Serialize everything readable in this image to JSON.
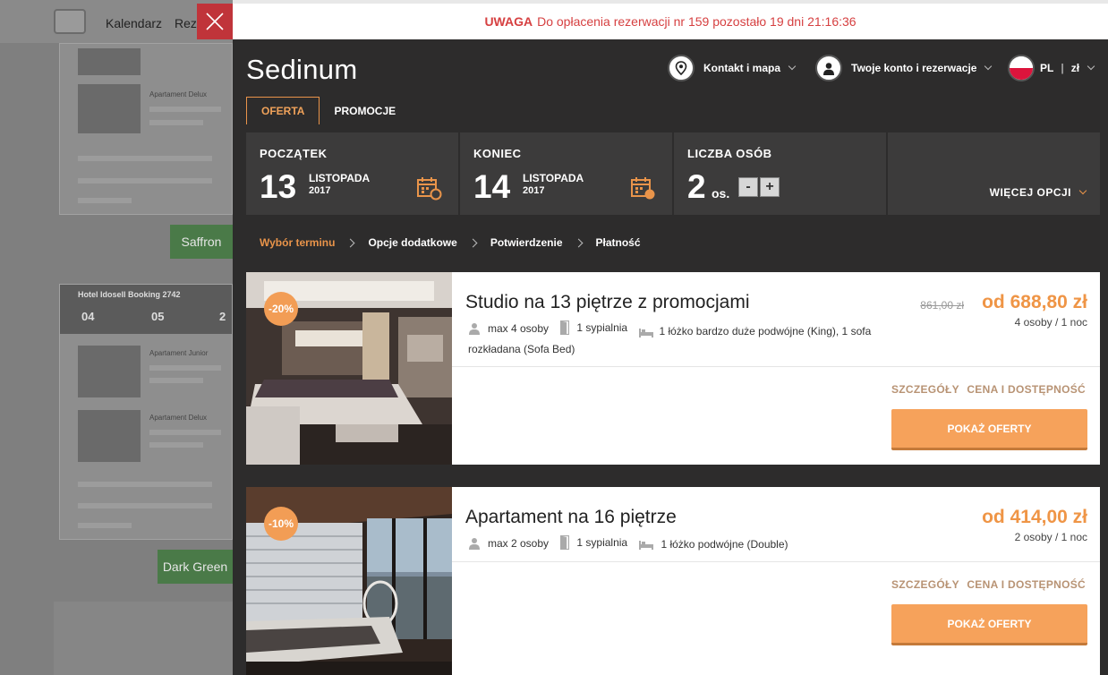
{
  "background": {
    "nav": {
      "calendar": "Kalendarz",
      "reservations": "Reze"
    },
    "preview_hotel": "Hotel Idosell Booking 2742",
    "preview_rooms": [
      "Apartament Junior",
      "Apartament Delux"
    ],
    "preview_days": [
      "04",
      "05",
      "2"
    ],
    "theme_buttons": [
      "Saffron",
      "Dark Green"
    ]
  },
  "warning": {
    "label": "UWAGA",
    "text": "Do opłacenia rezerwacji nr 159 pozostało 19 dni 21:16:36"
  },
  "hotel": {
    "name": "Sedinum"
  },
  "menu": {
    "contact": "Kontakt i mapa",
    "account": "Twoje konto i rezerwacje",
    "lang": "PL",
    "currency": "zł"
  },
  "tabs": [
    "OFERTA",
    "PROMOCJE"
  ],
  "search": {
    "start": {
      "label": "POCZĄTEK",
      "day": "13",
      "month": "LISTOPADA",
      "year": "2017"
    },
    "end": {
      "label": "KONIEC",
      "day": "14",
      "month": "LISTOPADA",
      "year": "2017"
    },
    "people": {
      "label": "LICZBA OSÓB",
      "count": "2",
      "unit": "os.",
      "minus": "-",
      "plus": "+"
    },
    "more": "WIĘCEJ OPCJI"
  },
  "steps": [
    "Wybór terminu",
    "Opcje dodatkowe",
    "Potwierdzenie",
    "Płatność"
  ],
  "offers": [
    {
      "title": "Studio na 13 piętrze z promocjami",
      "badge": "-20%",
      "guests": "max 4 osoby",
      "bedrooms": "1 sypialnia",
      "beds": "1 łóżko bardzo duże podwójne (King), 1 sofa rozkładana (Sofa Bed)",
      "old_price": "861,00 zł",
      "price": "od 688,80 zł",
      "per": "4 osoby / 1 noc",
      "details": "SZCZEGÓŁY",
      "availability": "CENA I DOSTĘPNOŚĆ",
      "cta": "POKAŻ OFERTY"
    },
    {
      "title": "Apartament na 16 piętrze",
      "badge": "-10%",
      "guests": "max 2 osoby",
      "bedrooms": "1 sypialnia",
      "beds": "1 łóżko podwójne (Double)",
      "old_price": "",
      "price": "od 414,00 zł",
      "per": "2 osoby / 1 noc",
      "details": "SZCZEGÓŁY",
      "availability": "CENA I DOSTĘPNOŚĆ",
      "cta": "POKAŻ OFERTY"
    }
  ],
  "colors": {
    "accent": "#ef9546",
    "warning": "#d64041",
    "panel": "#2d2c2c"
  }
}
